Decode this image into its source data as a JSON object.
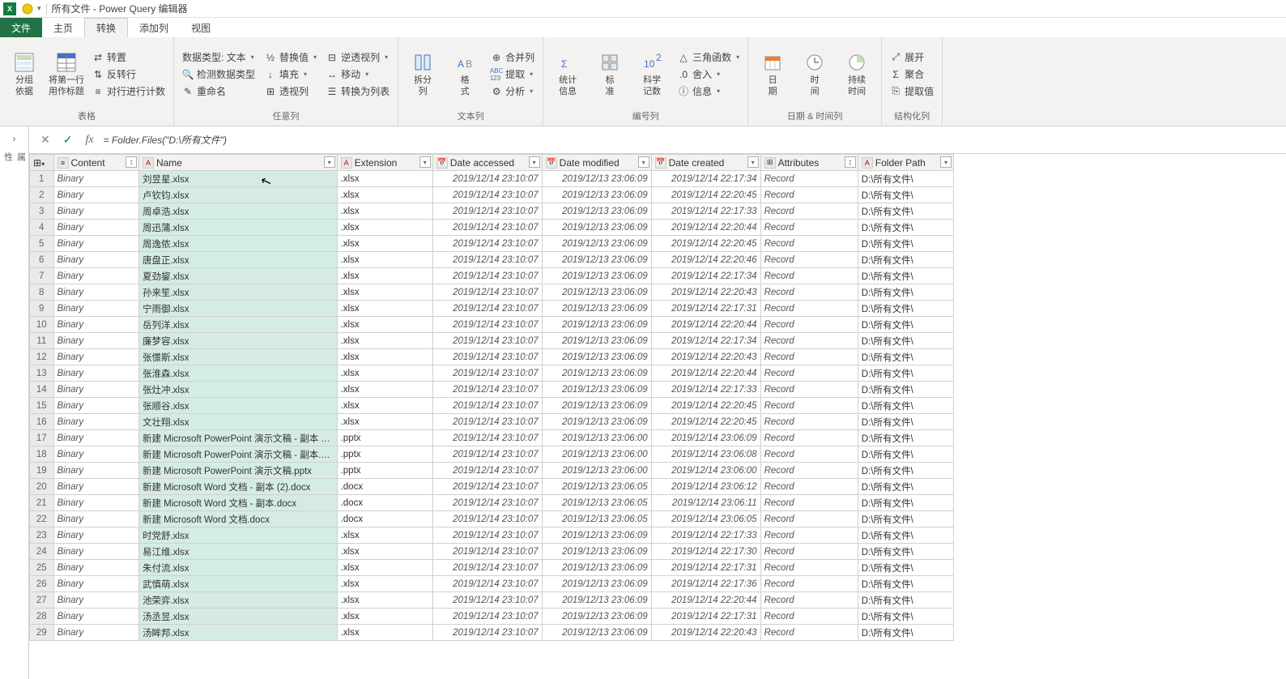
{
  "title": "所有文件 - Power Query 编辑器",
  "tabs": {
    "file": "文件",
    "home": "主页",
    "transform": "转换",
    "addcol": "添加列",
    "view": "视图"
  },
  "ribbon": {
    "g_table": {
      "label": "表格",
      "groupby": "分组\n依据",
      "firstrow": "将第一行\n用作标题",
      "transpose": "转置",
      "reverse": "反转行",
      "countrows": "对行进行计数"
    },
    "g_anycol": {
      "label": "任意列",
      "datatype": "数据类型: 文本",
      "detect": "检测数据类型",
      "rename": "重命名",
      "replace": "替换值",
      "fill": "填充",
      "pivot": "透视列",
      "unpivot": "逆透视列",
      "move": "移动",
      "tolist": "转换为列表"
    },
    "g_textcol": {
      "label": "文本列",
      "split": "拆分\n列",
      "format": "格\n式",
      "merge": "合并列",
      "extract": "提取",
      "parse": "分析"
    },
    "g_numcol": {
      "label": "编号列",
      "stats": "统计\n信息",
      "standard": "标\n准",
      "sci": "科学\n记数",
      "trig": "三角函数",
      "round": "舍入",
      "info": "信息"
    },
    "g_datecol": {
      "label": "日期 & 时间列",
      "date": "日\n期",
      "time": "时\n间",
      "duration": "持续\n时间"
    },
    "g_struct": {
      "label": "结构化列",
      "expand": "展开",
      "aggregate": "聚合",
      "extractval": "提取值"
    }
  },
  "formula": "= Folder.Files(\"D:\\所有文件\")",
  "side": "属\n性",
  "columns": {
    "content": "Content",
    "name": "Name",
    "extension": "Extension",
    "accessed": "Date accessed",
    "modified": "Date modified",
    "created": "Date created",
    "attributes": "Attributes",
    "folderpath": "Folder Path"
  },
  "rows": [
    {
      "n": 1,
      "content": "Binary",
      "name": "刘昱星.xlsx",
      "ext": ".xlsx",
      "da": "2019/12/14 23:10:07",
      "dm": "2019/12/13 23:06:09",
      "dc": "2019/12/14 22:17:34",
      "attr": "Record",
      "fp": "D:\\所有文件\\"
    },
    {
      "n": 2,
      "content": "Binary",
      "name": "卢钦钧.xlsx",
      "ext": ".xlsx",
      "da": "2019/12/14 23:10:07",
      "dm": "2019/12/13 23:06:09",
      "dc": "2019/12/14 22:20:45",
      "attr": "Record",
      "fp": "D:\\所有文件\\"
    },
    {
      "n": 3,
      "content": "Binary",
      "name": "周卓浩.xlsx",
      "ext": ".xlsx",
      "da": "2019/12/14 23:10:07",
      "dm": "2019/12/13 23:06:09",
      "dc": "2019/12/14 22:17:33",
      "attr": "Record",
      "fp": "D:\\所有文件\\"
    },
    {
      "n": 4,
      "content": "Binary",
      "name": "周迅蒲.xlsx",
      "ext": ".xlsx",
      "da": "2019/12/14 23:10:07",
      "dm": "2019/12/13 23:06:09",
      "dc": "2019/12/14 22:20:44",
      "attr": "Record",
      "fp": "D:\\所有文件\\"
    },
    {
      "n": 5,
      "content": "Binary",
      "name": "周逸侬.xlsx",
      "ext": ".xlsx",
      "da": "2019/12/14 23:10:07",
      "dm": "2019/12/13 23:06:09",
      "dc": "2019/12/14 22:20:45",
      "attr": "Record",
      "fp": "D:\\所有文件\\"
    },
    {
      "n": 6,
      "content": "Binary",
      "name": "唐盘正.xlsx",
      "ext": ".xlsx",
      "da": "2019/12/14 23:10:07",
      "dm": "2019/12/13 23:06:09",
      "dc": "2019/12/14 22:20:46",
      "attr": "Record",
      "fp": "D:\\所有文件\\"
    },
    {
      "n": 7,
      "content": "Binary",
      "name": "夏劲鋆.xlsx",
      "ext": ".xlsx",
      "da": "2019/12/14 23:10:07",
      "dm": "2019/12/13 23:06:09",
      "dc": "2019/12/14 22:17:34",
      "attr": "Record",
      "fp": "D:\\所有文件\\"
    },
    {
      "n": 8,
      "content": "Binary",
      "name": "孙来笙.xlsx",
      "ext": ".xlsx",
      "da": "2019/12/14 23:10:07",
      "dm": "2019/12/13 23:06:09",
      "dc": "2019/12/14 22:20:43",
      "attr": "Record",
      "fp": "D:\\所有文件\\"
    },
    {
      "n": 9,
      "content": "Binary",
      "name": "宁雨御.xlsx",
      "ext": ".xlsx",
      "da": "2019/12/14 23:10:07",
      "dm": "2019/12/13 23:06:09",
      "dc": "2019/12/14 22:17:31",
      "attr": "Record",
      "fp": "D:\\所有文件\\"
    },
    {
      "n": 10,
      "content": "Binary",
      "name": "岳列洋.xlsx",
      "ext": ".xlsx",
      "da": "2019/12/14 23:10:07",
      "dm": "2019/12/13 23:06:09",
      "dc": "2019/12/14 22:20:44",
      "attr": "Record",
      "fp": "D:\\所有文件\\"
    },
    {
      "n": 11,
      "content": "Binary",
      "name": "廉梦容.xlsx",
      "ext": ".xlsx",
      "da": "2019/12/14 23:10:07",
      "dm": "2019/12/13 23:06:09",
      "dc": "2019/12/14 22:17:34",
      "attr": "Record",
      "fp": "D:\\所有文件\\"
    },
    {
      "n": 12,
      "content": "Binary",
      "name": "张憬斯.xlsx",
      "ext": ".xlsx",
      "da": "2019/12/14 23:10:07",
      "dm": "2019/12/13 23:06:09",
      "dc": "2019/12/14 22:20:43",
      "attr": "Record",
      "fp": "D:\\所有文件\\"
    },
    {
      "n": 13,
      "content": "Binary",
      "name": "张淮森.xlsx",
      "ext": ".xlsx",
      "da": "2019/12/14 23:10:07",
      "dm": "2019/12/13 23:06:09",
      "dc": "2019/12/14 22:20:44",
      "attr": "Record",
      "fp": "D:\\所有文件\\"
    },
    {
      "n": 14,
      "content": "Binary",
      "name": "张灶冲.xlsx",
      "ext": ".xlsx",
      "da": "2019/12/14 23:10:07",
      "dm": "2019/12/13 23:06:09",
      "dc": "2019/12/14 22:17:33",
      "attr": "Record",
      "fp": "D:\\所有文件\\"
    },
    {
      "n": 15,
      "content": "Binary",
      "name": "张顺谷.xlsx",
      "ext": ".xlsx",
      "da": "2019/12/14 23:10:07",
      "dm": "2019/12/13 23:06:09",
      "dc": "2019/12/14 22:20:45",
      "attr": "Record",
      "fp": "D:\\所有文件\\"
    },
    {
      "n": 16,
      "content": "Binary",
      "name": "文壮翔.xlsx",
      "ext": ".xlsx",
      "da": "2019/12/14 23:10:07",
      "dm": "2019/12/13 23:06:09",
      "dc": "2019/12/14 22:20:45",
      "attr": "Record",
      "fp": "D:\\所有文件\\"
    },
    {
      "n": 17,
      "content": "Binary",
      "name": "新建 Microsoft PowerPoint 演示文稿 - 副本 (…",
      "ext": ".pptx",
      "da": "2019/12/14 23:10:07",
      "dm": "2019/12/13 23:06:00",
      "dc": "2019/12/14 23:06:09",
      "attr": "Record",
      "fp": "D:\\所有文件\\"
    },
    {
      "n": 18,
      "content": "Binary",
      "name": "新建 Microsoft PowerPoint 演示文稿 - 副本.p…",
      "ext": ".pptx",
      "da": "2019/12/14 23:10:07",
      "dm": "2019/12/13 23:06:00",
      "dc": "2019/12/14 23:06:08",
      "attr": "Record",
      "fp": "D:\\所有文件\\"
    },
    {
      "n": 19,
      "content": "Binary",
      "name": "新建 Microsoft PowerPoint 演示文稿.pptx",
      "ext": ".pptx",
      "da": "2019/12/14 23:10:07",
      "dm": "2019/12/13 23:06:00",
      "dc": "2019/12/14 23:06:00",
      "attr": "Record",
      "fp": "D:\\所有文件\\"
    },
    {
      "n": 20,
      "content": "Binary",
      "name": "新建 Microsoft Word 文档 - 副本 (2).docx",
      "ext": ".docx",
      "da": "2019/12/14 23:10:07",
      "dm": "2019/12/13 23:06:05",
      "dc": "2019/12/14 23:06:12",
      "attr": "Record",
      "fp": "D:\\所有文件\\"
    },
    {
      "n": 21,
      "content": "Binary",
      "name": "新建 Microsoft Word 文档 - 副本.docx",
      "ext": ".docx",
      "da": "2019/12/14 23:10:07",
      "dm": "2019/12/13 23:06:05",
      "dc": "2019/12/14 23:06:11",
      "attr": "Record",
      "fp": "D:\\所有文件\\"
    },
    {
      "n": 22,
      "content": "Binary",
      "name": "新建 Microsoft Word 文档.docx",
      "ext": ".docx",
      "da": "2019/12/14 23:10:07",
      "dm": "2019/12/13 23:06:05",
      "dc": "2019/12/14 23:06:05",
      "attr": "Record",
      "fp": "D:\\所有文件\\"
    },
    {
      "n": 23,
      "content": "Binary",
      "name": "时党舒.xlsx",
      "ext": ".xlsx",
      "da": "2019/12/14 23:10:07",
      "dm": "2019/12/13 23:06:09",
      "dc": "2019/12/14 22:17:33",
      "attr": "Record",
      "fp": "D:\\所有文件\\"
    },
    {
      "n": 24,
      "content": "Binary",
      "name": "易江维.xlsx",
      "ext": ".xlsx",
      "da": "2019/12/14 23:10:07",
      "dm": "2019/12/13 23:06:09",
      "dc": "2019/12/14 22:17:30",
      "attr": "Record",
      "fp": "D:\\所有文件\\"
    },
    {
      "n": 25,
      "content": "Binary",
      "name": "朱付流.xlsx",
      "ext": ".xlsx",
      "da": "2019/12/14 23:10:07",
      "dm": "2019/12/13 23:06:09",
      "dc": "2019/12/14 22:17:31",
      "attr": "Record",
      "fp": "D:\\所有文件\\"
    },
    {
      "n": 26,
      "content": "Binary",
      "name": "武慎萌.xlsx",
      "ext": ".xlsx",
      "da": "2019/12/14 23:10:07",
      "dm": "2019/12/13 23:06:09",
      "dc": "2019/12/14 22:17:36",
      "attr": "Record",
      "fp": "D:\\所有文件\\"
    },
    {
      "n": 27,
      "content": "Binary",
      "name": "池荣弈.xlsx",
      "ext": ".xlsx",
      "da": "2019/12/14 23:10:07",
      "dm": "2019/12/13 23:06:09",
      "dc": "2019/12/14 22:20:44",
      "attr": "Record",
      "fp": "D:\\所有文件\\"
    },
    {
      "n": 28,
      "content": "Binary",
      "name": "汤丞昱.xlsx",
      "ext": ".xlsx",
      "da": "2019/12/14 23:10:07",
      "dm": "2019/12/13 23:06:09",
      "dc": "2019/12/14 22:17:31",
      "attr": "Record",
      "fp": "D:\\所有文件\\"
    },
    {
      "n": 29,
      "content": "Binary",
      "name": "汤眸邦.xlsx",
      "ext": ".xlsx",
      "da": "2019/12/14 23:10:07",
      "dm": "2019/12/13 23:06:09",
      "dc": "2019/12/14 22:20:43",
      "attr": "Record",
      "fp": "D:\\所有文件\\"
    }
  ]
}
